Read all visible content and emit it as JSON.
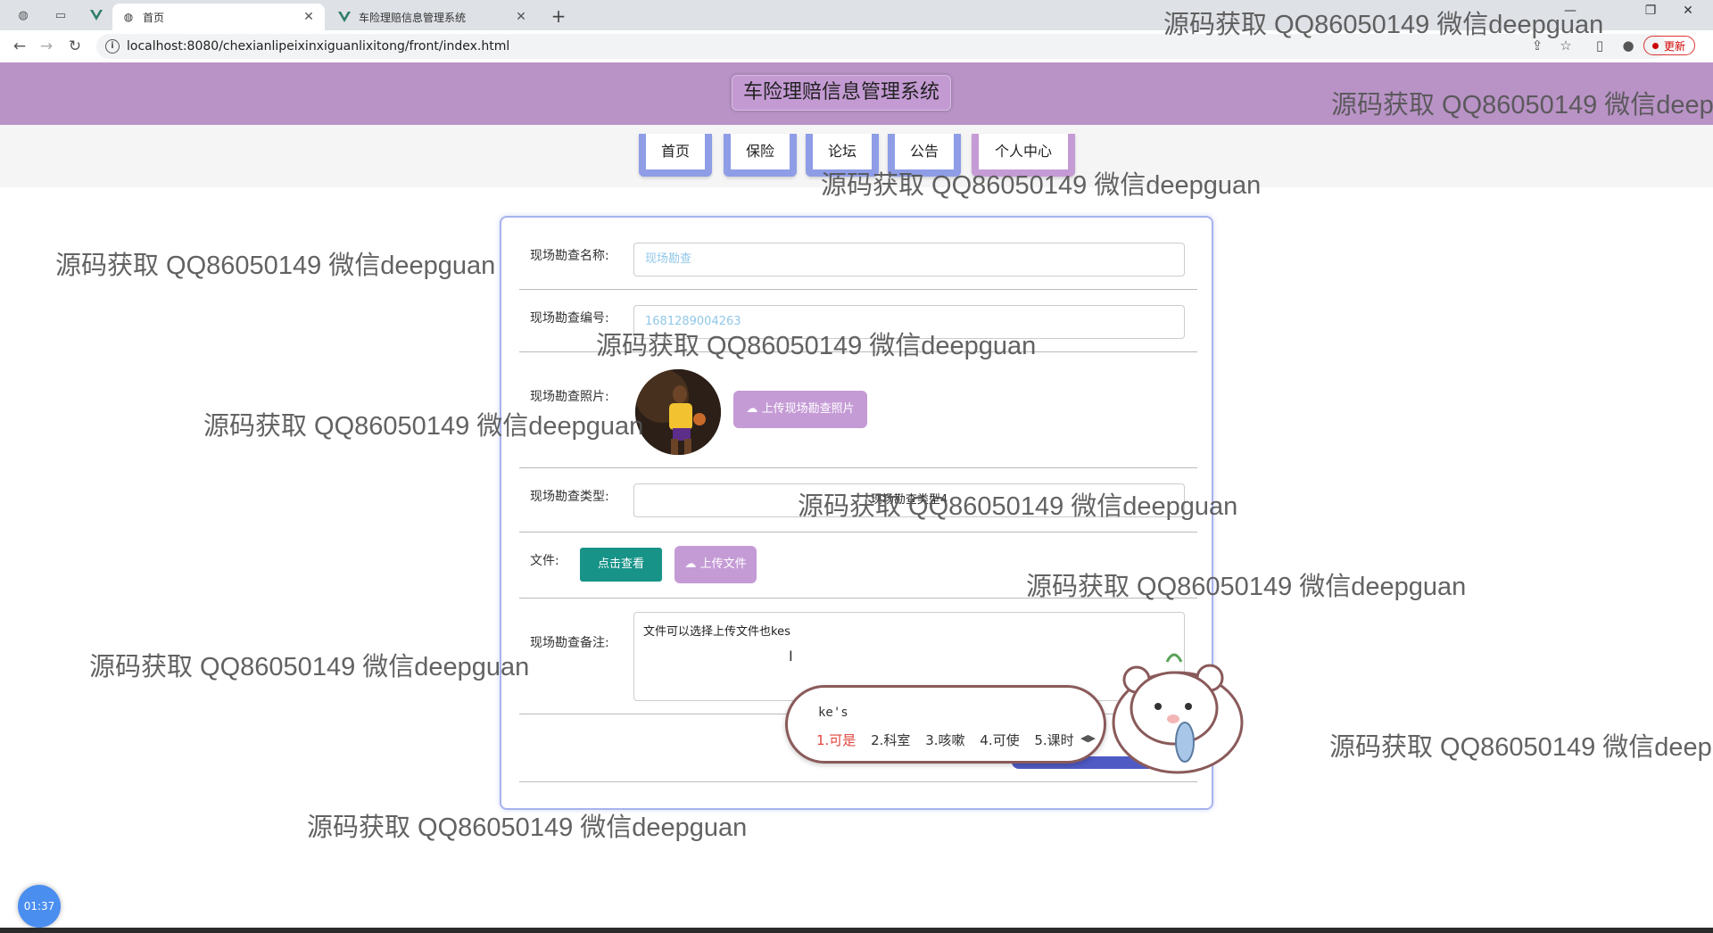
{
  "browser": {
    "tabs": [
      {
        "title": "首页",
        "icon": "globe-icon",
        "active": true
      },
      {
        "title": "车险理赔信息管理系统",
        "icon": "vue-icon",
        "active": false
      }
    ],
    "url": "localhost:8080/chexianlipeixinxiguanlixitong/front/index.html",
    "update_label": "更新"
  },
  "site": {
    "title": "车险理赔信息管理系统",
    "nav": [
      "首页",
      "保险",
      "论坛",
      "公告",
      "个人中心"
    ]
  },
  "form": {
    "name_label": "现场勘查名称:",
    "name_placeholder": "现场勘查",
    "number_label": "现场勘查编号:",
    "number_value": "1681289004263",
    "photo_label": "现场勘查照片:",
    "photo_upload_label": "上传现场勘查照片",
    "type_label": "现场勘查类型:",
    "type_value": "现场勘查类型4",
    "file_label": "文件:",
    "view_button": "点击查看",
    "file_upload_label": "上传文件",
    "remark_label": "现场勘查备注:",
    "remark_value": "文件可以选择上传文件也kes"
  },
  "ime": {
    "composition": "ke's",
    "candidates": [
      "1.可是",
      "2.科室",
      "3.咳嗽",
      "4.可使",
      "5.课时"
    ]
  },
  "watermark": "源码获取 QQ86050149 微信deepguan",
  "timer": "01:37",
  "colors": {
    "header": "#b993c6",
    "nav_border": "#8e9de6",
    "accent_pink": "#c59bd6",
    "teal": "#179388"
  }
}
